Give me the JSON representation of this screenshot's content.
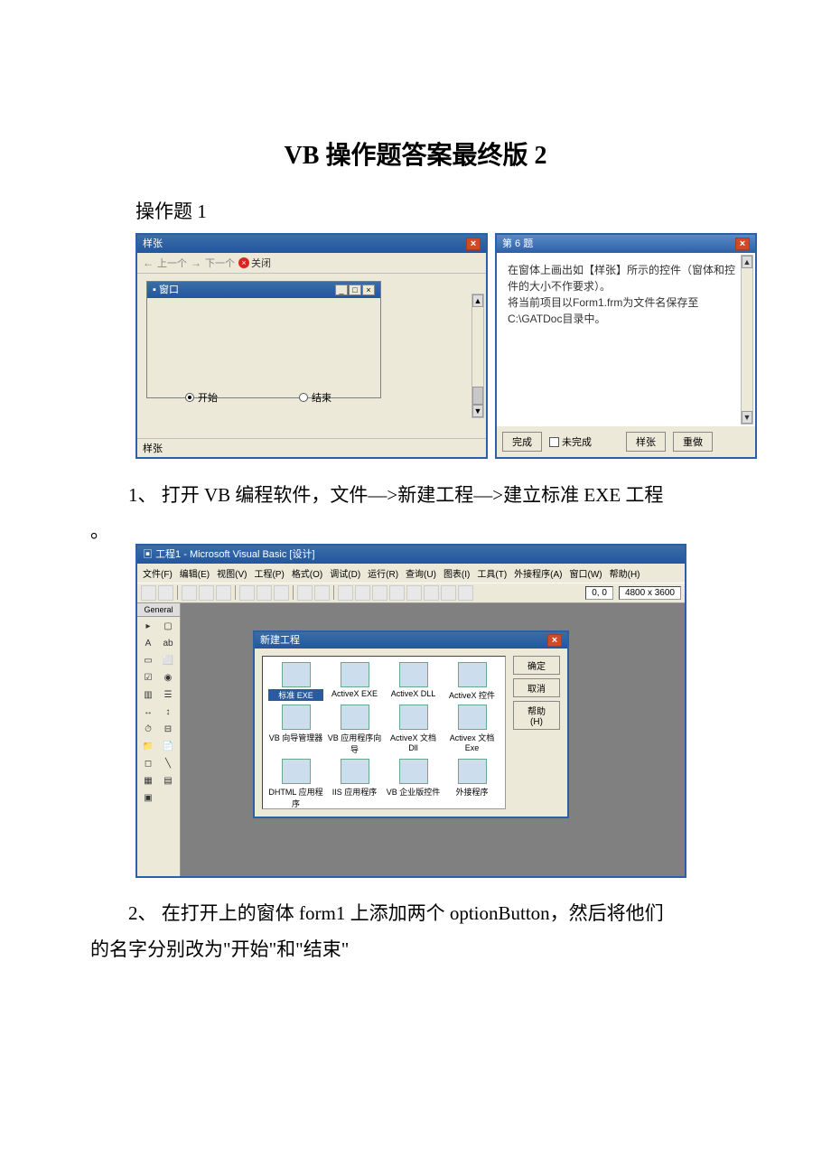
{
  "doc": {
    "title": "VB 操作题答案最终版 2",
    "section_heading": "操作题 1",
    "step1": "1、 打开 VB 编程软件，文件—>新建工程—>建立标准 EXE 工程",
    "step1_tail": "。",
    "step2_line1": "2、 在打开上的窗体 form1 上添加两个 optionButton，然后将他们",
    "step2_line2": "的名字分别改为\"开始\"和\"结束\""
  },
  "shot1": {
    "sample_title": "样张",
    "toolbar_prev": "上一个",
    "toolbar_next": "下一个",
    "toolbar_close": "关闭",
    "inner_title": "窗口",
    "radio_start": "开始",
    "radio_end": "结束",
    "status": "样张",
    "q_title": "第 6 题",
    "q_body_l1": "在窗体上画出如【样张】所示的控件（窗体和控件的大小不作要求）。",
    "q_body_l2": "将当前项目以Form1.frm为文件名保存至C:\\GATDoc目录中。",
    "btn_done": "完成",
    "btn_undone": "未完成",
    "btn_sample": "样张",
    "btn_redo": "重做"
  },
  "shot2": {
    "ide_title": "工程1 - Microsoft Visual Basic [设计]",
    "menus": [
      "文件(F)",
      "编辑(E)",
      "视图(V)",
      "工程(P)",
      "格式(O)",
      "调试(D)",
      "运行(R)",
      "查询(U)",
      "图表(I)",
      "工具(T)",
      "外接程序(A)",
      "窗口(W)",
      "帮助(H)"
    ],
    "coord_pos": "0, 0",
    "coord_size": "4800 x 3600",
    "toolbox_header": "General",
    "dlg_title": "新建工程",
    "dlg_ok": "确定",
    "dlg_cancel": "取消",
    "dlg_help": "帮助(H)",
    "proj_items": [
      {
        "label": "标准 EXE",
        "sel": true
      },
      {
        "label": "ActiveX EXE"
      },
      {
        "label": "ActiveX DLL"
      },
      {
        "label": "ActiveX 控件"
      },
      {
        "label": "VB 向导管理器"
      },
      {
        "label": "VB 应用程序向导"
      },
      {
        "label": "ActiveX 文档 Dll"
      },
      {
        "label": "Activex 文档 Exe"
      },
      {
        "label": "DHTML 应用程序"
      },
      {
        "label": "IIS 应用程序"
      },
      {
        "label": "VB 企业版控件"
      },
      {
        "label": "外接程序"
      }
    ]
  }
}
